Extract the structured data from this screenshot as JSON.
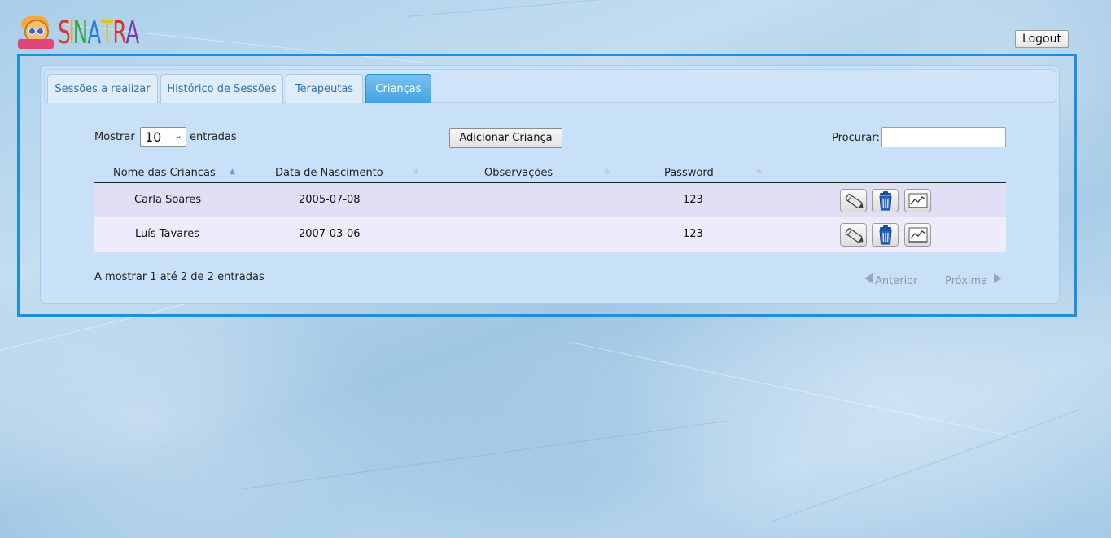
{
  "logo": {
    "letters": [
      "S",
      "I",
      "N",
      "A",
      "T",
      "R",
      "A"
    ],
    "colors": [
      "#d93434",
      "#f0a81c",
      "#35a845",
      "#2b7bd6",
      "#e4c21e",
      "#d93434",
      "#7b3ab0"
    ]
  },
  "header": {
    "logout_label": "Logout"
  },
  "tabs": [
    {
      "label": "Sessões a realizar",
      "active": false
    },
    {
      "label": "Histórico de Sessões",
      "active": false
    },
    {
      "label": "Terapeutas",
      "active": false
    },
    {
      "label": "Crianças",
      "active": true
    }
  ],
  "controls": {
    "show_prefix": "Mostrar",
    "page_size": "10",
    "show_suffix": "entradas",
    "add_button_label": "Adicionar Criança",
    "search_label": "Procurar:",
    "search_value": ""
  },
  "table": {
    "columns": [
      "Nome das Criancas",
      "Data de Nascimento",
      "Observações",
      "Password"
    ],
    "sorted_column": "Nome das Criancas",
    "sort_direction": "ascending",
    "rows": [
      {
        "name": "Carla Soares",
        "birthdate": "2005-07-08",
        "notes": "",
        "password": "123",
        "actions": [
          "edit-icon",
          "trash-icon",
          "chart-icon"
        ]
      },
      {
        "name": "Luís Tavares",
        "birthdate": "2007-03-06",
        "notes": "",
        "password": "123",
        "actions": [
          "edit-icon",
          "trash-icon",
          "chart-icon"
        ]
      }
    ]
  },
  "footer": {
    "info": "A mostrar 1 até 2 de 2 entradas",
    "prev_label": "Anterior",
    "next_label": "Próxima"
  },
  "colors": {
    "accent": "#1d8fde",
    "active_tab": "#42a3e4",
    "panel": "#c8e0f8"
  }
}
